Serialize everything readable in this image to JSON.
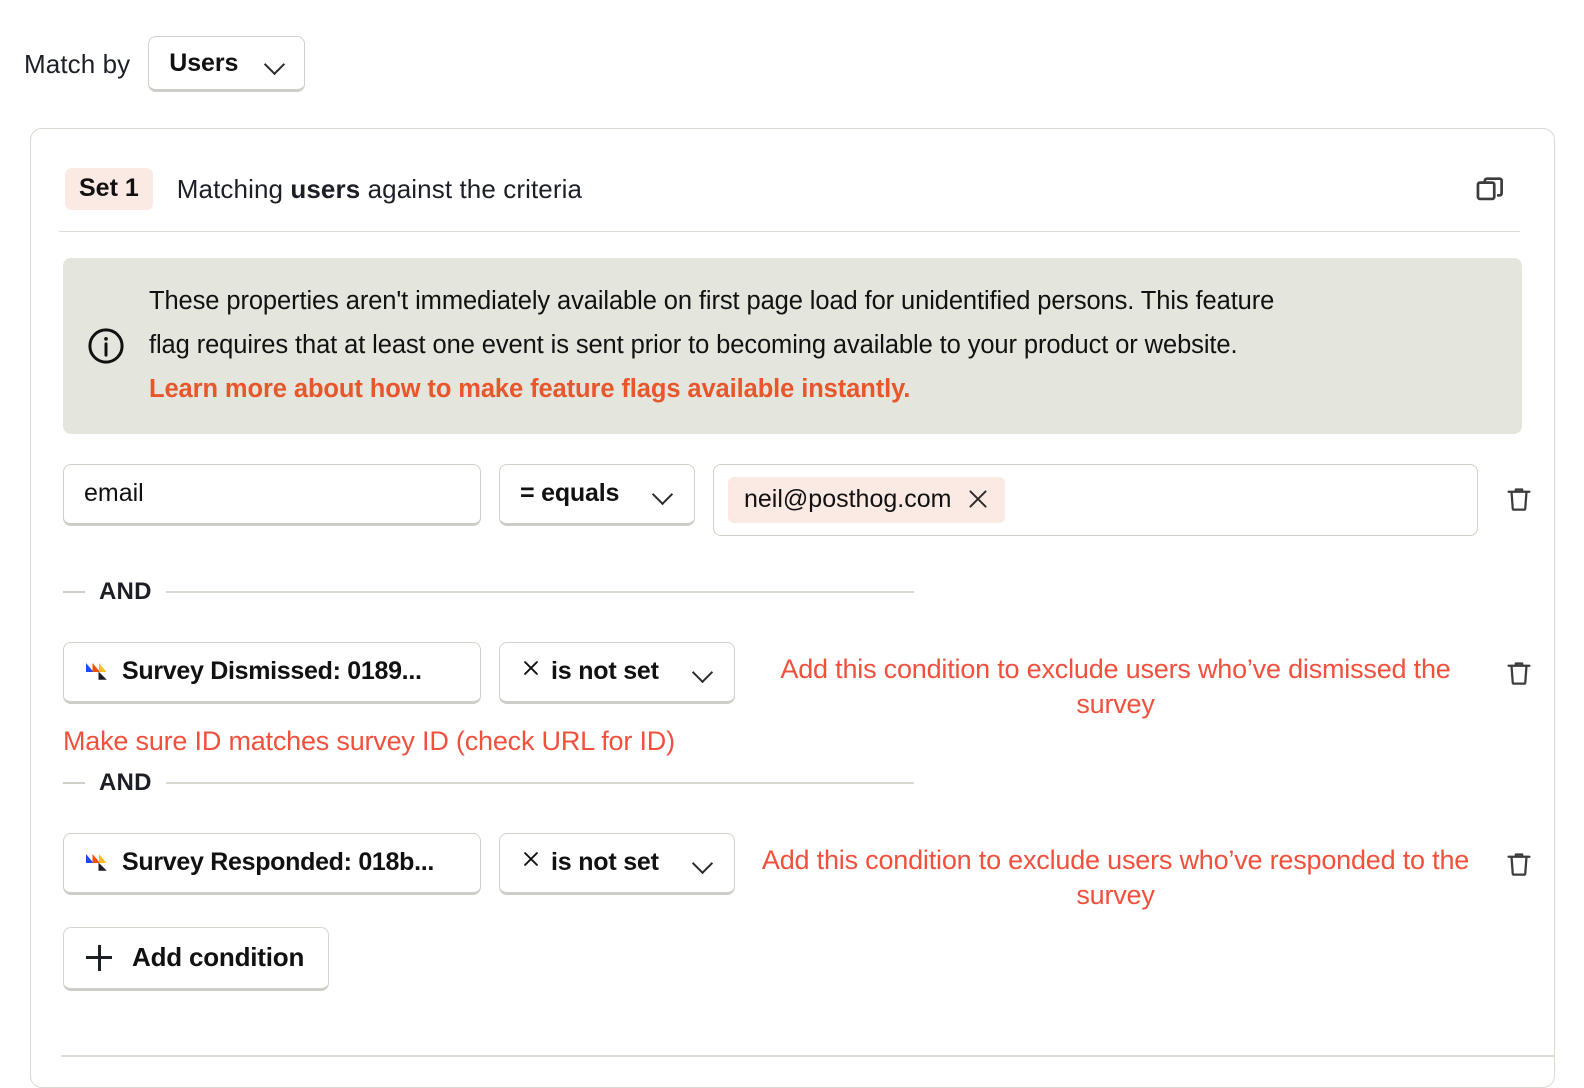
{
  "match_by": {
    "label": "Match by",
    "selected": "Users",
    "chevron_icon": "chevron-down-icon"
  },
  "card": {
    "set_badge": "Set 1",
    "header_prefix": "Matching ",
    "header_bold": "users",
    "header_suffix": " against the criteria",
    "copy_icon": "duplicate-icon"
  },
  "banner": {
    "icon": "info-circle-icon",
    "line1": "These properties aren't immediately available on first page load for unidentified persons. This feature",
    "line2": "flag requires that at least one event is sent prior to becoming available to your product or website.",
    "link": "Learn more about how to make feature flags available instantly.",
    "background": "#e4e6dd",
    "link_color": "#e8562b"
  },
  "conditions": [
    {
      "key": "email",
      "key_icon": null,
      "operator": "= equals",
      "operator_icon": null,
      "value_chip": "neil@posthog.com",
      "chip_remove_icon": "close-icon",
      "delete_icon": "trash-icon"
    },
    {
      "key": "Survey Dismissed: 0189...",
      "key_icon": "event-stripes-icon",
      "operator": "is not set",
      "operator_icon": "close-x-icon",
      "delete_icon": "trash-icon",
      "annotation": "Add this condition to exclude users who’ve dismissed the survey",
      "note": "Make sure ID matches survey ID (check URL for ID)"
    },
    {
      "key": "Survey Responded: 018b...",
      "key_icon": "event-stripes-icon",
      "operator": "is not set",
      "operator_icon": "close-x-icon",
      "delete_icon": "trash-icon",
      "annotation": "Add this condition to exclude users who’ve responded to the survey"
    }
  ],
  "separators": {
    "and": "AND"
  },
  "add_condition": {
    "label": "Add condition",
    "icon": "plus-icon"
  },
  "colors": {
    "accent_red": "#f0503c",
    "link_orange": "#e8562b",
    "chip_bg": "#fbe9e3",
    "banner_bg": "#e4e6dd",
    "border": "#d0d1c9"
  }
}
